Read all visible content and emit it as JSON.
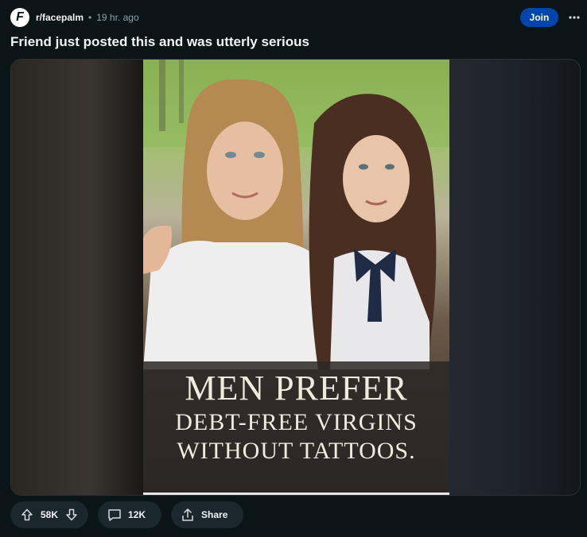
{
  "post": {
    "subreddit": "r/facepalm",
    "avatar_letter": "F",
    "separator": "•",
    "time": "19 hr. ago",
    "join_label": "Join",
    "title": "Friend just posted this and was utterly serious"
  },
  "media": {
    "caption_line1": "MEN PREFER",
    "caption_line2": "DEBT-FREE VIRGINS",
    "caption_line3": "WITHOUT TATTOOS."
  },
  "actions": {
    "upvotes": "58K",
    "comments": "12K",
    "share_label": "Share"
  },
  "colors": {
    "background": "#0b1416",
    "join": "#0045ac",
    "pill": "#1a282d"
  },
  "icons": [
    "upvote-icon",
    "downvote-icon",
    "comment-icon",
    "share-icon",
    "more-icon"
  ]
}
